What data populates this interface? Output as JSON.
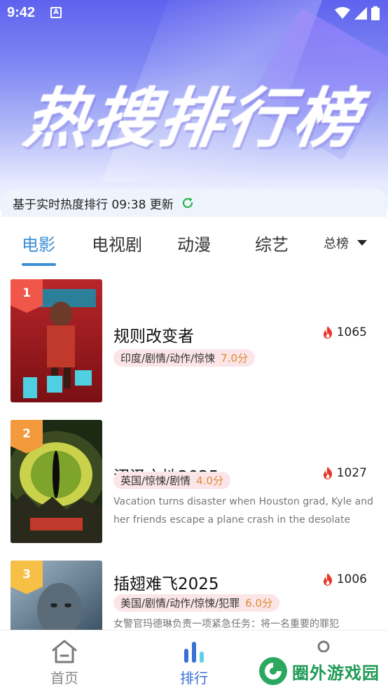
{
  "status_bar": {
    "time": "9:42"
  },
  "hero": {
    "title": "热搜排行榜"
  },
  "info": {
    "text": "基于实时热度排行 09:38 更新"
  },
  "tabs": [
    {
      "label": "电影",
      "active": true
    },
    {
      "label": "电视剧"
    },
    {
      "label": "动漫"
    },
    {
      "label": "综艺"
    }
  ],
  "rank_select": {
    "selected": "总榜"
  },
  "items": [
    {
      "rank": "1",
      "title": "规则改变者",
      "heat": "1065",
      "tags": "印度/剧情/动作/惊悚",
      "score": "7.0分",
      "description": "",
      "badge_color": "#f0564a"
    },
    {
      "rank": "2",
      "title": "沼泽之地2025",
      "heat": "1027",
      "tags": "英国/惊悚/剧情",
      "score": "4.0分",
      "description": "Vacation turns disaster when Houston grad, Kyle and her friends escape a plane crash in the desolate",
      "badge_color": "#f39a3c"
    },
    {
      "rank": "3",
      "title": "插翅难飞2025",
      "heat": "1006",
      "tags": "美国/剧情/动作/惊悚/犯罪",
      "score": "6.0分",
      "description": "女警官玛德琳负责一项紧急任务：将一名重要的罪犯",
      "badge_color": "#f6c046"
    }
  ],
  "bottom_nav": [
    {
      "label": "首页",
      "icon": "home-icon"
    },
    {
      "label": "排行",
      "icon": "chart-bars-icon",
      "active": true
    },
    {
      "label": "",
      "icon": "profile-icon"
    }
  ],
  "watermark": {
    "text": "圈外游戏园"
  },
  "colors": {
    "accent": "#3a8fd6",
    "heat": "#e8372c",
    "score": "#e08a2e",
    "tag_bg": "#fbe5e8"
  }
}
